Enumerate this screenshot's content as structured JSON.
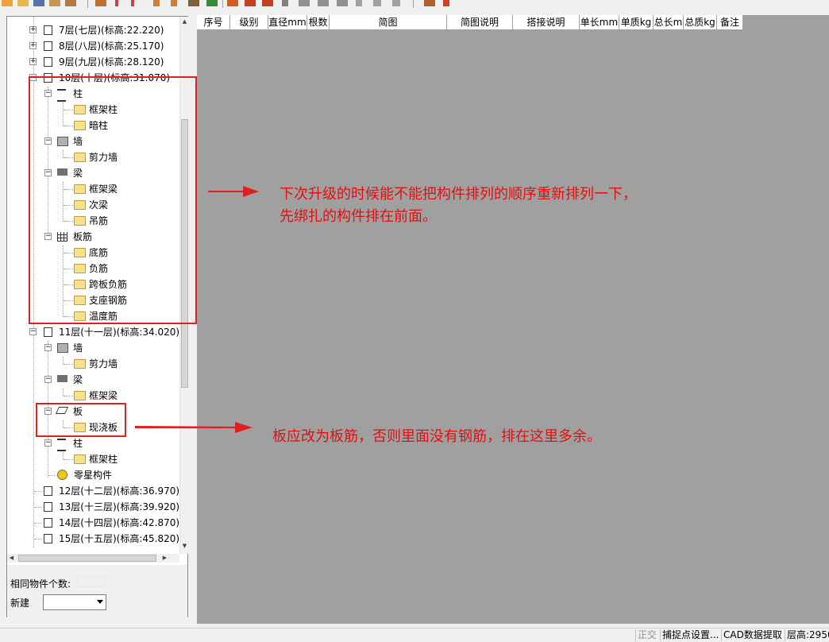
{
  "toolbar": {
    "icons": [
      "new-icon",
      "open-icon",
      "save-icon",
      "edit-icon",
      "edit2-icon",
      "draw-icon",
      "line-icon",
      "line2-icon",
      "pen-icon",
      "pen2-icon",
      "filter-icon",
      "refresh-icon",
      "stack-icon",
      "copy-icon",
      "copy2-icon",
      "cut-icon",
      "paste-icon",
      "paste2-icon",
      "paste3-icon",
      "delete-icon",
      "up-icon",
      "down-icon",
      "calc-icon",
      "help-icon"
    ]
  },
  "tree": {
    "floor7": "7层(七层)(标高:22.220)",
    "floor8": "8层(八层)(标高:25.170)",
    "floor9": "9层(九层)(标高:28.120)",
    "floor10": "10层(十层)(标高:31.070)",
    "zhu": "柱",
    "kuangjiazhu": "框架柱",
    "anzhu": "暗柱",
    "qiang": "墙",
    "jianliqiang": "剪力墙",
    "liang": "梁",
    "kuangjialiang": "框架梁",
    "ciliang": "次梁",
    "diaojin": "吊筋",
    "banjin": "板筋",
    "dijin": "底筋",
    "fujin": "负筋",
    "kuabanfujin": "跨板负筋",
    "zhizuogangjin": "支座钢筋",
    "wendujin": "温度筋",
    "floor11": "11层(十一层)(标高:34.020)",
    "qiang11": "墙",
    "jianliqiang11": "剪力墙",
    "liang11": "梁",
    "kuangjialiang11": "框架梁",
    "ban11": "板",
    "xianjiaoban11": "现浇板",
    "zhu11": "柱",
    "kuangjiazhu11": "框架柱",
    "lingxing11": "零星构件",
    "floor12": "12层(十二层)(标高:36.970)",
    "floor13": "13层(十三层)(标高:39.920)",
    "floor14": "14层(十四层)(标高:42.870)",
    "floor15": "15层(十五层)(标高:45.820)"
  },
  "bottom": {
    "count_label": "相同物件个数:",
    "new_label": "新建"
  },
  "table": {
    "headers": [
      "序号",
      "级别",
      "直径mm",
      "根数",
      "简图",
      "简图说明",
      "搭接说明",
      "单长mm",
      "单质kg",
      "总长m",
      "总质kg",
      "备注"
    ]
  },
  "annotations": {
    "note1_line1": "下次升级的时候能不能把构件排列的顺序重新排列一下，",
    "note1_line2": "先绑扎的构件排在前面。",
    "note2": "板应改为板筋，否则里面没有钢筋，排在这里多余。"
  },
  "status": {
    "s1": "正交",
    "s2": "捕捉点设置...",
    "s3": "CAD数据提取",
    "s4": "层高:2950"
  },
  "colors": {
    "annotation": "#e02020",
    "workspace": "#a0a0a0"
  }
}
